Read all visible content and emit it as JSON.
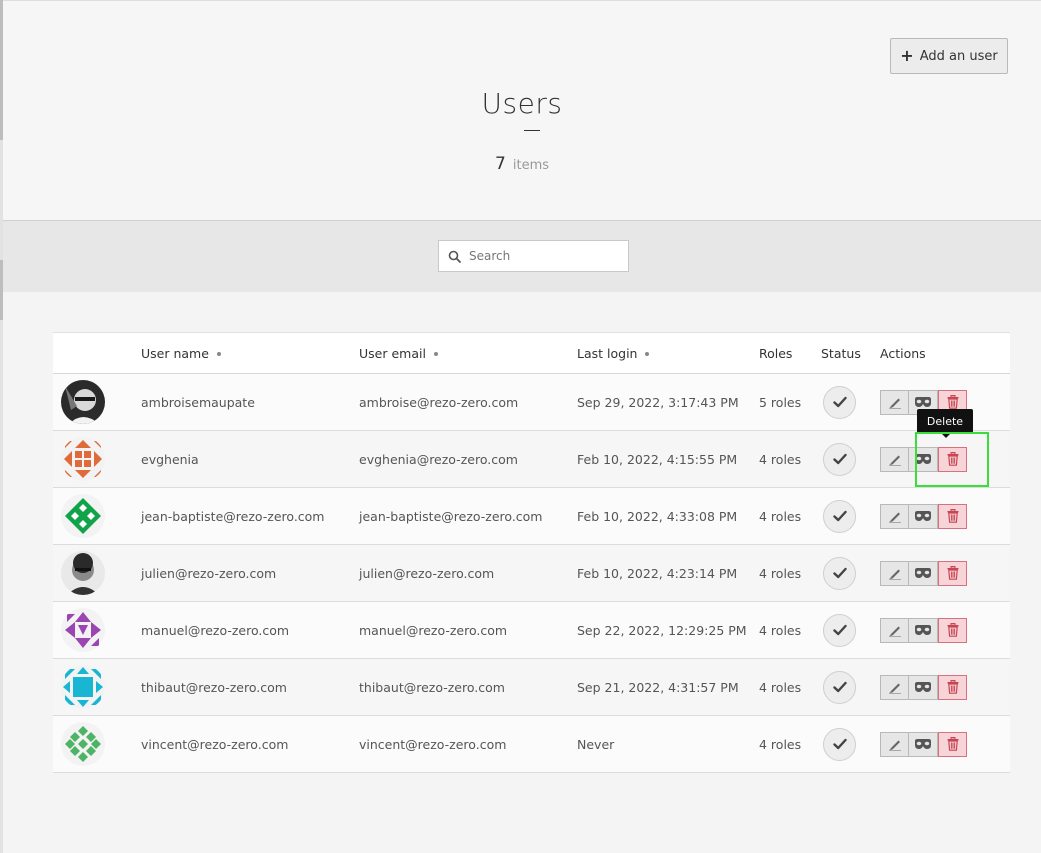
{
  "header": {
    "add_button_label": "Add an user",
    "title": "Users",
    "count": "7",
    "count_unit": "items"
  },
  "search": {
    "placeholder": "Search"
  },
  "table": {
    "columns": [
      "",
      "User name",
      "User email",
      "Last login",
      "Roles",
      "Status",
      "Actions"
    ],
    "rows": [
      {
        "name": "ambroisemaupate",
        "email": "ambroise@rezo-zero.com",
        "last_login": "Sep 29, 2022, 3:17:43 PM",
        "roles": "5 roles",
        "avatar": "photo-portrait-1"
      },
      {
        "name": "evghenia",
        "email": "evghenia@rezo-zero.com",
        "last_login": "Feb 10, 2022, 4:15:55 PM",
        "roles": "4 roles",
        "avatar": "identicon-orange"
      },
      {
        "name": "jean-baptiste@rezo-zero.com",
        "email": "jean-baptiste@rezo-zero.com",
        "last_login": "Feb 10, 2022, 4:33:08 PM",
        "roles": "4 roles",
        "avatar": "identicon-green"
      },
      {
        "name": "julien@rezo-zero.com",
        "email": "julien@rezo-zero.com",
        "last_login": "Feb 10, 2022, 4:23:14 PM",
        "roles": "4 roles",
        "avatar": "photo-portrait-2"
      },
      {
        "name": "manuel@rezo-zero.com",
        "email": "manuel@rezo-zero.com",
        "last_login": "Sep 22, 2022, 12:29:25 PM",
        "roles": "4 roles",
        "avatar": "identicon-purple"
      },
      {
        "name": "thibaut@rezo-zero.com",
        "email": "thibaut@rezo-zero.com",
        "last_login": "Sep 21, 2022, 4:31:57 PM",
        "roles": "4 roles",
        "avatar": "identicon-cyan"
      },
      {
        "name": "vincent@rezo-zero.com",
        "email": "vincent@rezo-zero.com",
        "last_login": "Never",
        "roles": "4 roles",
        "avatar": "identicon-lightgreen"
      }
    ]
  },
  "tooltip": {
    "text": "Delete"
  },
  "icons": {
    "add": "plus-icon",
    "search": "search-icon",
    "status": "check-icon",
    "edit": "pencil-icon",
    "impersonate": "mask-icon",
    "delete": "trash-icon"
  },
  "colors": {
    "delete_bg": "#f7d4d7",
    "delete_border": "#d9707d",
    "delete_icon": "#c94552",
    "highlight": "#3ddc3d",
    "avatar_orange": "#e06b3a",
    "avatar_green": "#11a34a",
    "avatar_purple": "#9b45b3",
    "avatar_cyan": "#19b6d3",
    "avatar_lightgreen": "#4db365"
  }
}
